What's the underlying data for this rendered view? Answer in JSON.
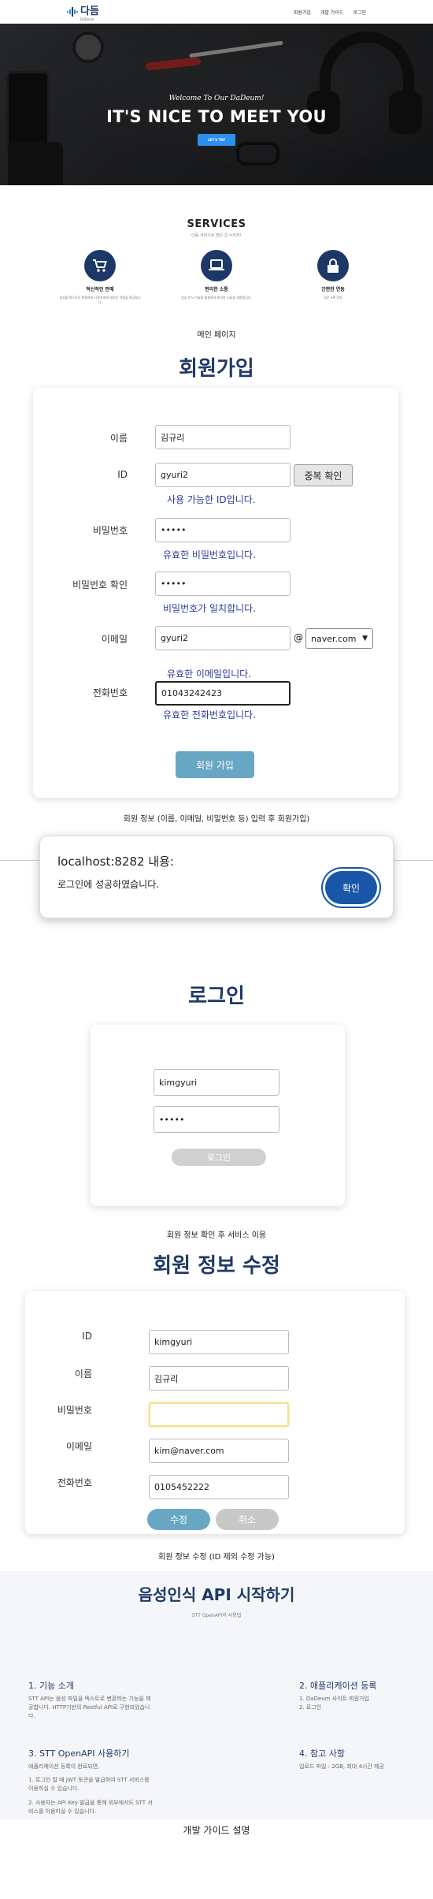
{
  "nav": {
    "brand": "다듬",
    "brand_sub": "DaDeum",
    "links": [
      "회원가입",
      "개발 가이드",
      "로그인"
    ]
  },
  "hero": {
    "subtitle": "Welcome To Our DaDeum!",
    "title": "IT'S NICE TO MEET YOU",
    "button": "LET'S TRY"
  },
  "services": {
    "title": "SERVICES",
    "subtitle": "다듬 서비스로 많은 걸 누리자!",
    "items": [
      {
        "icon": "cart-icon",
        "name": "혁신적인 판매",
        "desc": "음성을 텍스트로 변환하여 사용자에게 새로운 경험을 제공합니다."
      },
      {
        "icon": "laptop-icon",
        "name": "편리한 소통",
        "desc": "음성 인식 기술을 활용하여 편리한 소통을 실현합니다."
      },
      {
        "icon": "lock-icon",
        "name": "간편한 연동",
        "desc": "쉬운 API 연동"
      }
    ]
  },
  "captions": {
    "main": "메인 페이지",
    "signup": "회원 정보 (이름, 이메일, 비밀번호 등) 입력 후 회원가입)",
    "login": "회원 정보 확인 후 서비스 이용",
    "edit": "회원 정보 수정 (ID 제외 수정 가능)",
    "guide": "개발 가이드 설명"
  },
  "signup": {
    "title": "회원가입",
    "name_label": "이름",
    "name_value": "김규리",
    "id_label": "ID",
    "id_value": "gyuri2",
    "dup_button": "중복 확인",
    "id_msg": "사용 가능한 ID입니다.",
    "pw_label": "비밀번호",
    "pw_value": "•••••",
    "pw_msg": "유효한 비밀번호입니다.",
    "pw2_label": "비밀번호 확인",
    "pw2_value": "•••••",
    "pw2_msg": "비밀번호가 일치합니다.",
    "email_label": "이메일",
    "email_value": "gyuri2",
    "at": "@",
    "domain": "naver.com",
    "email_msg": "유효한 이메일입니다.",
    "phone_label": "전화번호",
    "phone_value": "01043242423",
    "phone_msg": "유효한 전화번호입니다.",
    "submit": "회원 가입"
  },
  "alert": {
    "title": "localhost:8282 내용:",
    "message": "로그인에 성공하였습니다.",
    "ok": "확인"
  },
  "login": {
    "title": "로그인",
    "id_value": "kimgyuri",
    "pw_value": "•••••",
    "button": "로그인"
  },
  "edit": {
    "title": "회원 정보 수정",
    "id_label": "ID",
    "id_value": "kimgyuri",
    "name_label": "이름",
    "name_value": "김규리",
    "pw_label": "비밀번호",
    "pw_value": "",
    "email_label": "이메일",
    "email_value": "kim@naver.com",
    "phone_label": "전화번호",
    "phone_value": "0105452222",
    "save": "수정",
    "cancel": "취소"
  },
  "api": {
    "title": "음성인식 API 시작하기",
    "subtitle": "STT OpenAPI의 사용법",
    "s1_title": "1. 기능 소개",
    "s1_body": "STT API는 음성 파일을 텍스트로 변환하는 기능을 제공합니다. HTTP기반의 Restful API로 구현되었습니다.",
    "s2_title": "2. 애플리케이션 등록",
    "s2_body1": "1. DaDeum 사이트 회원가입",
    "s2_body2": "2. 로그인",
    "s3_title": "3. STT OpenAPI 사용하기",
    "s3_body0": "애플리케이션 등록이 완료되면,",
    "s3_body1": "1. 로그인 할 때 JWT 토큰을 발급하여 STT 서비스를 이용하실 수 있습니다.",
    "s3_body2": "2. 사용자는 API Key 발급을 통해 외부에서도 STT 서비스를 이용하실 수 있습니다.",
    "s4_title": "4. 참고 사항",
    "s4_body": "업로드 파일 : 2GB, 최대 4시간 제공"
  },
  "colors": {
    "navy": "#203a66",
    "accent": "#2d8ff0",
    "button": "#67a7c3",
    "alert_ok": "#1956a8",
    "valid_msg": "#2a3a9a"
  }
}
